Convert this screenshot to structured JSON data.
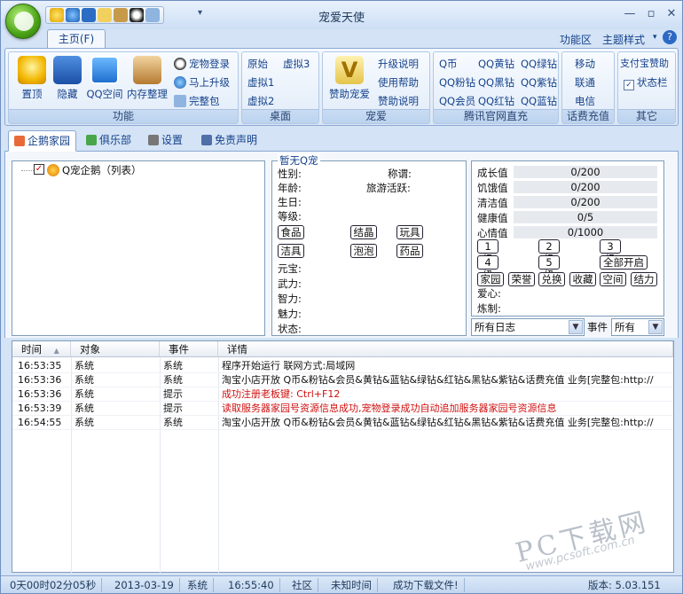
{
  "window": {
    "title": "宠爱天使"
  },
  "titlebar": {
    "minimize": "—",
    "restore": "▫",
    "close": "✕",
    "qat_more": "▾"
  },
  "ribbon_tabs": {
    "main": "主页(F)",
    "right_items": [
      "功能区",
      "主题样式"
    ],
    "right_arrow": "▾",
    "help": "?"
  },
  "groups": {
    "func": {
      "label": "功能",
      "buttons": [
        "置顶",
        "隐藏",
        "QQ空间",
        "内存整理"
      ],
      "small": [
        "宠物登录",
        "马上升级",
        "完整包"
      ]
    },
    "desk": {
      "label": "桌面",
      "items": [
        "原始",
        "虚拟3",
        "虚拟1",
        "虚拟2"
      ]
    },
    "pet": {
      "label": "宠爱",
      "big": "赞助宠爱",
      "small": [
        "升级说明",
        "使用帮助",
        "赞助说明"
      ]
    },
    "tencent": {
      "label": "腾讯官网直充",
      "items": [
        "Q币",
        "QQ黄钻",
        "QQ绿钻",
        "QQ粉钻",
        "QQ黑钻",
        "QQ紫钻",
        "QQ会员",
        "QQ红钻",
        "QQ蓝钻"
      ]
    },
    "phone": {
      "label": "话费充值",
      "items": [
        "移动",
        "联通",
        "电信"
      ]
    },
    "other": {
      "label": "其它",
      "items": [
        "支付宝赞助",
        "状态栏"
      ],
      "checkbox_checked": true
    }
  },
  "lower_tabs": [
    "企鹅家园",
    "俱乐部",
    "设置",
    "免责声明"
  ],
  "tree": {
    "root": "Q宠企鹅（列表）",
    "checked": true
  },
  "info": {
    "group_title": "暂无Q宠",
    "fields_left": [
      "性别:",
      "年龄:",
      "生日:",
      "等级:"
    ],
    "fields_right": [
      "称谓:",
      "旅游活跃:"
    ],
    "buttons": [
      "食品",
      "结晶",
      "玩具",
      "洁具",
      "泡泡",
      "药品"
    ],
    "attrs": [
      "元宝:",
      "武力:",
      "智力:",
      "魅力:",
      "状态:"
    ]
  },
  "stats": {
    "rows": [
      {
        "label": "成长值",
        "value": "0/200"
      },
      {
        "label": "饥饿值",
        "value": "0/200"
      },
      {
        "label": "清洁值",
        "value": "0/200"
      },
      {
        "label": "健康值",
        "value": "0/5"
      },
      {
        "label": "心情值",
        "value": "0/1000"
      }
    ],
    "level_buttons": [
      "1级",
      "2级",
      "3级",
      "4级",
      "5级",
      "全部开启"
    ],
    "action_buttons": [
      "家园",
      "荣誉",
      "兑换",
      "收藏",
      "空间",
      "结力"
    ],
    "extra": [
      "爱心:",
      "炼制:"
    ]
  },
  "filters": {
    "log_select": "所有日志",
    "event_label": "事件",
    "event_select": "所有"
  },
  "log": {
    "headers": [
      "时间",
      "对象",
      "事件",
      "详情"
    ],
    "sort_arrow": "▲",
    "rows": [
      {
        "time": "16:53:35",
        "obj": "系统",
        "event": "系统",
        "detail": "程序开始运行 联网方式:局域网",
        "color": "#111"
      },
      {
        "time": "16:53:36",
        "obj": "系统",
        "event": "系统",
        "detail": "淘宝小店开放 Q币&粉钻&会员&黄钻&蓝钻&绿钻&红钻&黑钻&紫钻&话费充值 业务[完整包:http://",
        "color": "#111"
      },
      {
        "time": "16:53:36",
        "obj": "系统",
        "event": "提示",
        "detail": "成功注册老板键: Ctrl+F12",
        "color": "#d01010"
      },
      {
        "time": "16:53:39",
        "obj": "系统",
        "event": "提示",
        "detail": "读取服务器家园号资源信息成功,宠物登录成功自动追加服务器家园号资源信息",
        "color": "#d01010"
      },
      {
        "time": "16:54:55",
        "obj": "系统",
        "event": "系统",
        "detail": "淘宝小店开放 Q币&粉钻&会员&黄钻&蓝钻&绿钻&红钻&黑钻&紫钻&话费充值 业务[完整包:http://",
        "color": "#111"
      }
    ]
  },
  "status": [
    "0天00时02分05秒",
    "2013-03-19",
    "系统",
    "16:55:40",
    "社区",
    "未知时间",
    "成功下载文件!",
    "版本: 5.03.151"
  ],
  "watermark": {
    "main": "PC下载网",
    "sub": "www.pcsoft.com.cn"
  }
}
